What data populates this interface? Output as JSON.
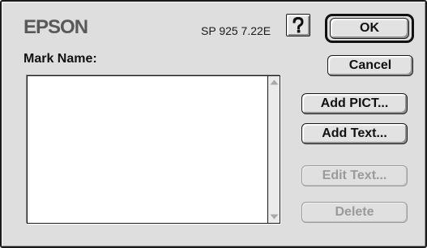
{
  "dialog": {
    "brand": "EPSON",
    "model": "SP 925 7.22E",
    "help_icon": "question-mark-icon",
    "mark_name_label": "Mark Name:",
    "mark_names": []
  },
  "buttons": {
    "ok": "OK",
    "cancel": "Cancel",
    "add_pict": "Add PICT...",
    "add_text": "Add Text...",
    "edit_text": "Edit Text...",
    "delete": "Delete"
  },
  "state": {
    "edit_text_enabled": false,
    "delete_enabled": false
  },
  "colors": {
    "dialog_background": "#dedede",
    "brand_text": "#595959",
    "disabled_text": "#9a9a9a"
  }
}
